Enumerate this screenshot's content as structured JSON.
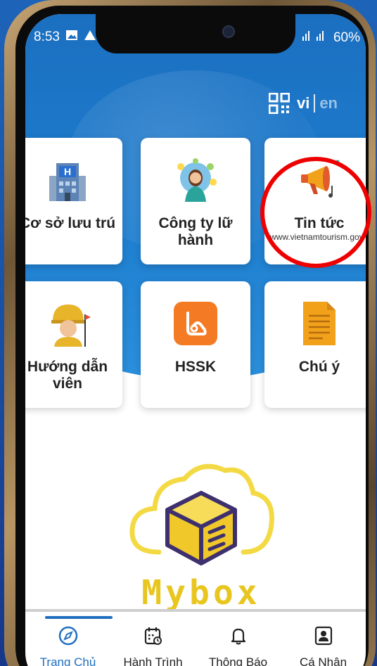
{
  "status": {
    "time": "8:53",
    "battery": "60%"
  },
  "language": {
    "active": "vi",
    "inactive": "en"
  },
  "cards": [
    {
      "title": "Cơ sở lưu trú",
      "subtitle": "",
      "icon": "hotel-icon"
    },
    {
      "title": "Công ty lữ hành",
      "subtitle": "",
      "icon": "travel-agent-icon"
    },
    {
      "title": "Tin tức",
      "subtitle": "www.vietnamtourism.gov.vn",
      "icon": "megaphone-icon"
    },
    {
      "title": "Hướng dẫn viên",
      "subtitle": "",
      "icon": "tour-guide-icon"
    },
    {
      "title": "HSSK",
      "subtitle": "",
      "icon": "health-record-icon"
    },
    {
      "title": "Chú ý",
      "subtitle": "",
      "icon": "note-icon"
    }
  ],
  "brand": {
    "name": "Mybox"
  },
  "tabs": [
    {
      "label": "Trang Chủ",
      "icon": "compass-icon",
      "active": true
    },
    {
      "label": "Hành Trình",
      "icon": "calendar-icon",
      "active": false
    },
    {
      "label": "Thông Báo",
      "icon": "bell-icon",
      "active": false
    },
    {
      "label": "Cá Nhân",
      "icon": "profile-icon",
      "active": false
    }
  ],
  "colors": {
    "primary": "#1f6fc1",
    "accent": "#e8c61f",
    "annotation": "#ee0000"
  }
}
